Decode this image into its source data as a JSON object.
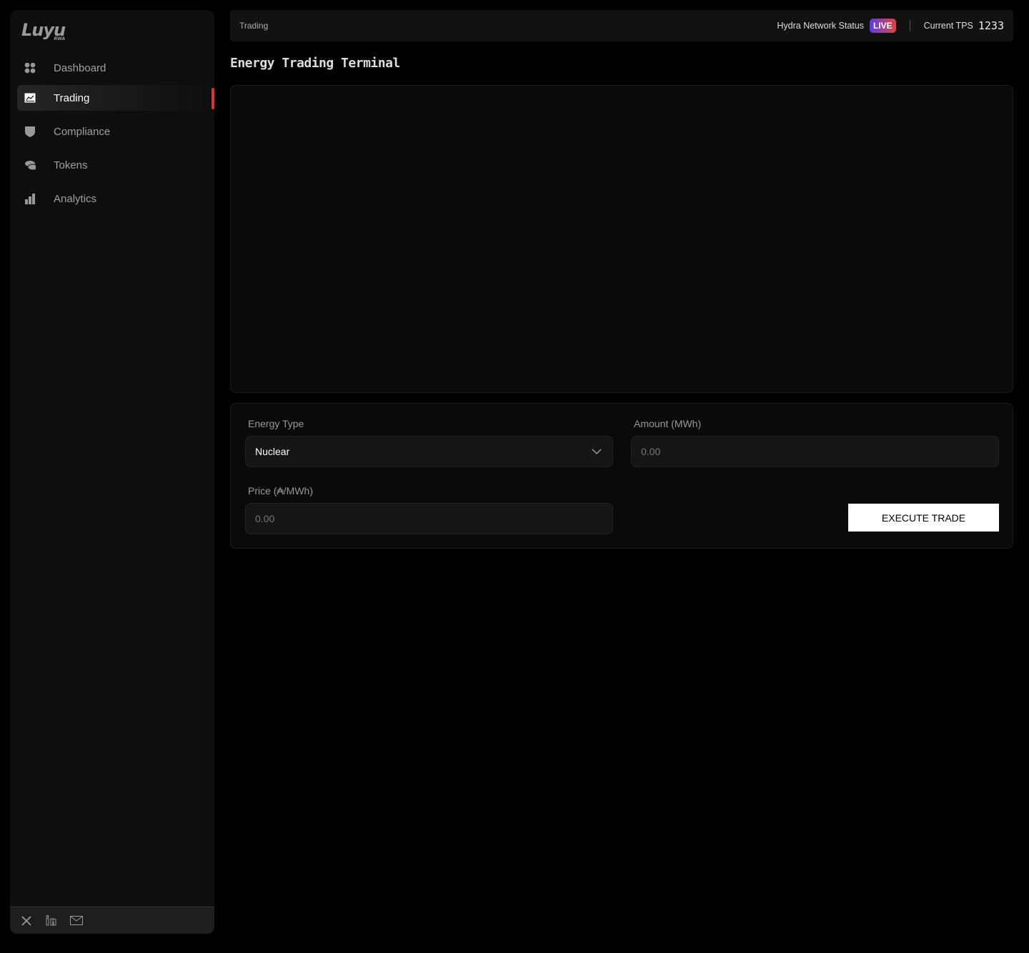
{
  "brand": {
    "logo_text": "Luyu",
    "logo_sub": "RWA"
  },
  "sidebar": {
    "items": [
      {
        "label": "Dashboard",
        "icon": "grid-icon"
      },
      {
        "label": "Trading",
        "icon": "chart-icon",
        "active": true
      },
      {
        "label": "Compliance",
        "icon": "shield-icon"
      },
      {
        "label": "Tokens",
        "icon": "coins-icon"
      },
      {
        "label": "Analytics",
        "icon": "bar-chart-icon"
      }
    ],
    "footer_icons": [
      "x-icon",
      "linkedin-icon",
      "mail-icon"
    ]
  },
  "header": {
    "breadcrumb": "Trading",
    "network_label": "Hydra Network Status",
    "status_badge": "LIVE",
    "tps_label": "Current TPS",
    "tps_value": "1233"
  },
  "page": {
    "title": "Energy Trading Terminal"
  },
  "form": {
    "energy_type_label": "Energy Type",
    "energy_type_value": "Nuclear",
    "amount_label": "Amount (MWh)",
    "amount_placeholder": "0.00",
    "price_label": "Price (₳/MWh)",
    "price_placeholder": "0.00",
    "execute_label": "EXECUTE TRADE"
  },
  "colors": {
    "accent": "#dd3333",
    "live_from": "#5a3ee8",
    "live_to": "#e0453a"
  }
}
